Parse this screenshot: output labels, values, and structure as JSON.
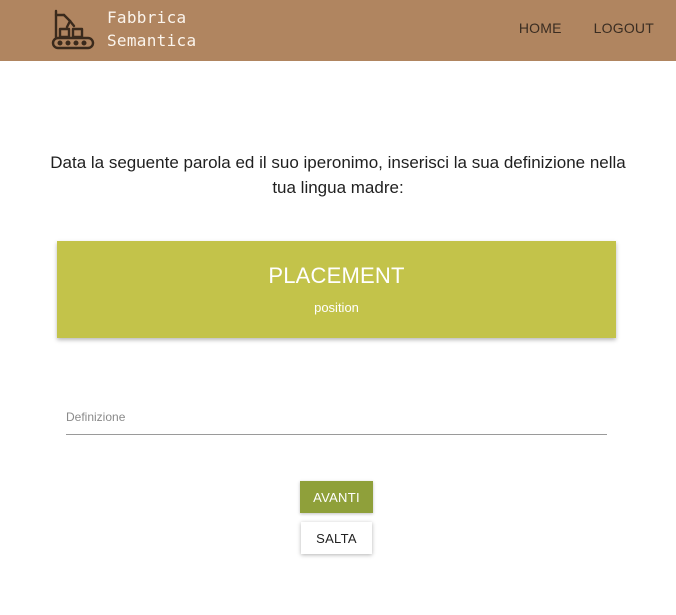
{
  "header": {
    "brand_icon": "factory-conveyor-robot-icon",
    "brand_name": "Fabbrica Semantica",
    "nav": {
      "home": "HOME",
      "logout": "LOGOUT"
    },
    "background_color": "#b08560"
  },
  "main": {
    "instruction": "Data la seguente parola ed il suo iperonimo, inserisci la sua definizione nella tua lingua madre:",
    "word_card": {
      "word": "PLACEMENT",
      "hypernym": "position",
      "background_color": "#c3c34a"
    },
    "definition_field": {
      "placeholder": "Definizione",
      "value": ""
    },
    "buttons": {
      "next": "AVANTI",
      "skip": "SALTA"
    },
    "accent_color": "#8fa03a"
  }
}
